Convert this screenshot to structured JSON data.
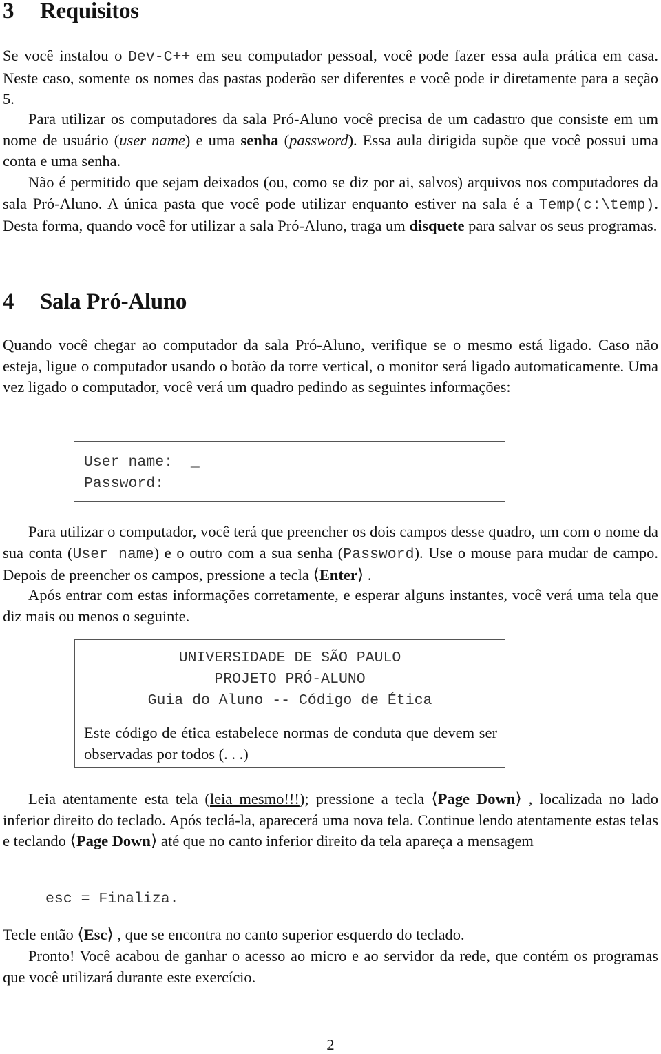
{
  "section3": {
    "number": "3",
    "title": "Requisitos",
    "p1": [
      {
        "t": "Se você instalou o ",
        "s": ""
      },
      {
        "t": "Dev-C++",
        "s": "tt"
      },
      {
        "t": " em seu computador pessoal, você pode fazer essa aula prática em casa.  Neste caso, somente os nomes das pastas poderão ser diferentes e você pode ir diretamente para a seção 5.",
        "s": ""
      }
    ],
    "p2": [
      {
        "t": "Para utilizar os computadores da sala Pró-Aluno você precisa de um cadastro que consiste em um nome de usuário (",
        "s": ""
      },
      {
        "t": "user name",
        "s": "i"
      },
      {
        "t": ") e uma ",
        "s": ""
      },
      {
        "t": "senha",
        "s": "b"
      },
      {
        "t": " (",
        "s": ""
      },
      {
        "t": "password",
        "s": "i"
      },
      {
        "t": ").  Essa aula dirigida supõe que você possui uma conta e uma senha.",
        "s": ""
      }
    ],
    "p3": [
      {
        "t": "Não é permitido que sejam deixados (ou, como se diz por ai, salvos) arquivos nos computadores da sala Pró-Aluno.  A única pasta que você pode utilizar enquanto estiver na sala é a ",
        "s": ""
      },
      {
        "t": "Temp(c:\\temp)",
        "s": "tt"
      },
      {
        "t": ". Desta forma, quando você for utilizar a sala Pró-Aluno, traga um ",
        "s": ""
      },
      {
        "t": "disquete",
        "s": "b"
      },
      {
        "t": " para salvar os seus programas.",
        "s": ""
      }
    ]
  },
  "section4": {
    "number": "4",
    "title": "Sala Pró-Aluno",
    "p1": [
      {
        "t": "Quando você chegar ao computador da sala Pró-Aluno, verifique se o mesmo está ligado. Caso não esteja, ligue o computador usando o botão da torre vertical, o monitor será ligado automaticamente.  Uma vez ligado o computador, você verá um quadro pedindo as seguintes informações:",
        "s": ""
      }
    ],
    "login_box": {
      "user_label": "User name:",
      "cursor": "_",
      "password_label": "Password:"
    },
    "p2": [
      {
        "t": "Para utilizar o computador, você terá que preencher os dois campos desse quadro, um com o nome da sua conta (",
        "s": ""
      },
      {
        "t": "User name",
        "s": "tt"
      },
      {
        "t": ") e o outro com a sua senha (",
        "s": ""
      },
      {
        "t": "Password",
        "s": "tt"
      },
      {
        "t": ").  Use o mouse para mudar de campo. Depois de preencher os campos, pressione a tecla ",
        "s": ""
      },
      {
        "t": "Enter",
        "s": "key"
      },
      {
        "t": " .",
        "s": ""
      }
    ],
    "p3": [
      {
        "t": "Após entrar com estas informações corretamente, e esperar alguns instantes, você verá uma tela que diz mais ou menos o seguinte.",
        "s": ""
      }
    ],
    "ethics_box": {
      "line1": "UNIVERSIDADE DE SÃO PAULO",
      "line2": "PROJETO PRÓ-ALUNO",
      "line3": "Guia do Aluno -- Código de Ética",
      "body": "Este código de ética estabelece normas de conduta que devem ser observadas por todos (. . .)"
    },
    "p4": [
      {
        "t": "Leia atentamente esta tela (",
        "s": ""
      },
      {
        "t": "leia mesmo!!!",
        "s": "u"
      },
      {
        "t": "); pressione a tecla ",
        "s": ""
      },
      {
        "t": "Page Down",
        "s": "key"
      },
      {
        "t": " , localizada no lado inferior direito do teclado.  Após teclá-la, aparecerá uma nova tela. Continue lendo atentamente estas telas e teclando ",
        "s": ""
      },
      {
        "t": "Page Down",
        "s": "key"
      },
      {
        "t": " até que no canto inferior direito da tela apareça a mensagem",
        "s": ""
      }
    ],
    "code_message": "esc = Finaliza.",
    "p5": [
      {
        "t": "Tecle então ",
        "s": ""
      },
      {
        "t": "Esc",
        "s": "key"
      },
      {
        "t": " , que se encontra no canto superior esquerdo do teclado.",
        "s": ""
      }
    ],
    "p6": [
      {
        "t": "Pronto!  Você acabou de ganhar o acesso ao micro e ao servidor da rede, que contém os programas que você utilizará durante este exercício.",
        "s": ""
      }
    ]
  },
  "page_number": "2"
}
